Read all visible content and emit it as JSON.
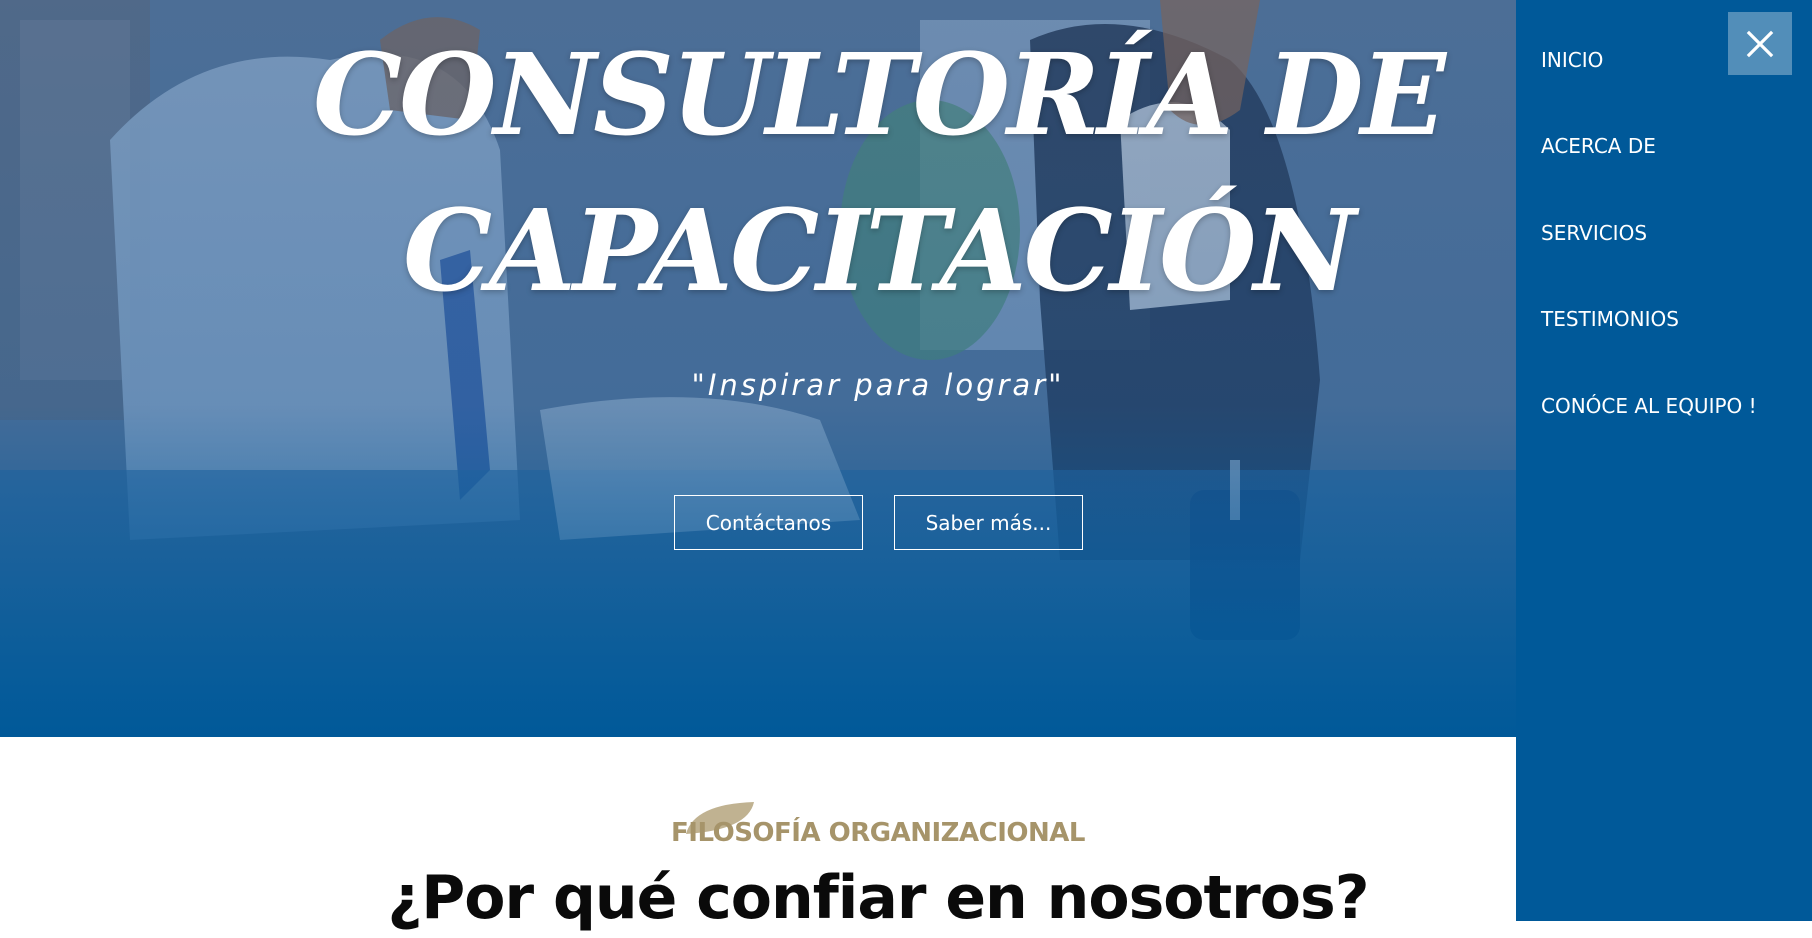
{
  "hero": {
    "title_line1": "CONSULTORÍA DE",
    "title_line2": "CAPACITACIÓN",
    "subtitle": "\"Inspirar para lograr\"",
    "buttons": {
      "contact_label": "Contáctanos",
      "more_label": "Saber más..."
    }
  },
  "section": {
    "kicker": "FILOSOFÍA ORGANIZACIONAL",
    "heading": "¿Por qué confiar en nosotros?"
  },
  "nav": {
    "items": [
      {
        "label": "INICIO"
      },
      {
        "label": "ACERCA DE"
      },
      {
        "label": "SERVICIOS"
      },
      {
        "label": "TESTIMONIOS"
      },
      {
        "label": "CONÓCE AL EQUIPO !"
      }
    ],
    "close_icon": "close-icon"
  },
  "colors": {
    "nav_background": "#005999",
    "hero_overlay": "#005999",
    "kicker": "#a6946a",
    "heading": "#0a0a0a",
    "button_border": "#ffffff"
  }
}
